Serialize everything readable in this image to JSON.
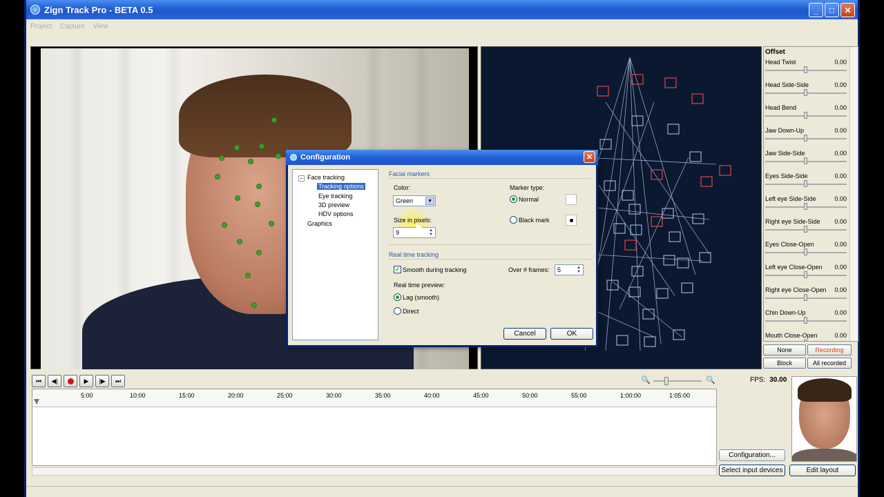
{
  "window": {
    "title": "Zign Track Pro - BETA 0.5"
  },
  "menu": [
    "Project",
    "Capture",
    "View"
  ],
  "offset": {
    "title": "Offset",
    "items": [
      {
        "name": "Head Twist",
        "value": "0.00"
      },
      {
        "name": "Head Side-Side",
        "value": "0.00"
      },
      {
        "name": "Head Bend",
        "value": "0.00"
      },
      {
        "name": "Jaw Down-Up",
        "value": "0.00"
      },
      {
        "name": "Jaw Side-Side",
        "value": "0.00"
      },
      {
        "name": "Eyes Side-Side",
        "value": "0.00"
      },
      {
        "name": "Left eye Side-Side",
        "value": "0.00"
      },
      {
        "name": "Right eye Side-Side",
        "value": "0.00"
      },
      {
        "name": "Eyes Close-Open",
        "value": "0.00"
      },
      {
        "name": "Left eye Close-Open",
        "value": "0.00"
      },
      {
        "name": "Right eye Close-Open",
        "value": "0.00"
      },
      {
        "name": "Chin Down-Up",
        "value": "0.00"
      },
      {
        "name": "Mouth Close-Open",
        "value": "0.00"
      }
    ]
  },
  "side_buttons": {
    "none": "None",
    "recording": "Recording",
    "block": "Block",
    "all_recorded": "All recorded"
  },
  "fps": {
    "label": "FPS:",
    "value": "30.00"
  },
  "timeline": {
    "ticks": [
      "5:00",
      "10:00",
      "15:00",
      "20:00",
      "25:00",
      "30:00",
      "35:00",
      "40:00",
      "45:00",
      "50:00",
      "55:00",
      "1:00:00",
      "1:05:00"
    ]
  },
  "buttons": {
    "configuration": "Configuration...",
    "select_input": "Select input devices",
    "edit_layout": "Edit layout"
  },
  "dialog": {
    "title": "Configuration",
    "tree": {
      "face_tracking": "Face tracking",
      "tracking_options": "Tracking options",
      "eye_tracking": "Eye tracking",
      "preview_3d": "3D preview",
      "hdv_options": "HDV options",
      "graphics": "Graphics"
    },
    "facial_markers": {
      "title": "Facial markers",
      "color_label": "Color:",
      "color_value": "Green",
      "size_label": "Size in pixels:",
      "size_value": "9",
      "marker_type_label": "Marker type:",
      "normal": "Normal",
      "black_mark": "Black mark"
    },
    "realtime": {
      "title": "Real time tracking",
      "smooth": "Smooth during tracking",
      "over_frames_label": "Over # frames:",
      "over_frames_value": "5",
      "preview_label": "Real time preview:",
      "lag": "Lag (smooth)",
      "direct": "Direct"
    },
    "cancel": "Cancel",
    "ok": "OK"
  },
  "colors": {
    "marker": "#3da12c",
    "title_blue": "#2462d8",
    "recording": "#d04020"
  }
}
